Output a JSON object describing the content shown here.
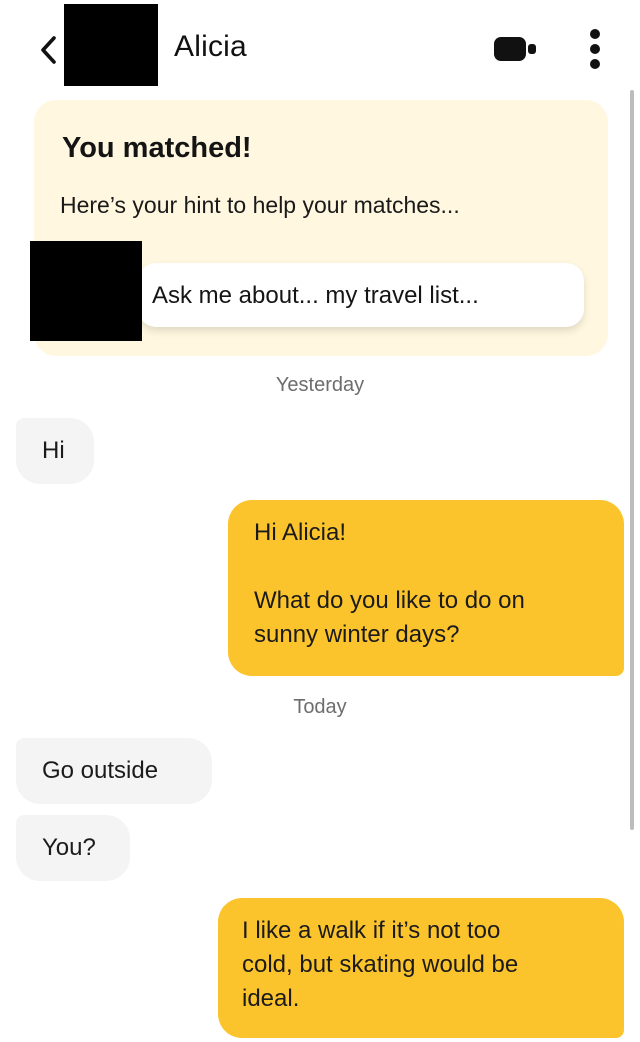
{
  "header": {
    "contact_name": "Alicia",
    "back_icon": "chevron-left-icon",
    "video_icon": "video-camera-icon",
    "more_icon": "more-vertical-icon"
  },
  "match_card": {
    "title": "You matched!",
    "subtitle": "Here’s your hint to help your matches...",
    "hint": "Ask me about... my travel list..."
  },
  "conversation": {
    "date_yesterday": "Yesterday",
    "date_today": "Today",
    "messages": [
      {
        "sender": "them",
        "lines": [
          "Hi"
        ]
      },
      {
        "sender": "me",
        "lines": [
          "Hi Alicia!",
          "What do you like to do on",
          "sunny winter days?"
        ]
      },
      {
        "sender": "them",
        "lines": [
          "Go outside"
        ]
      },
      {
        "sender": "them",
        "lines": [
          "You?"
        ]
      },
      {
        "sender": "me",
        "lines": [
          "I like a walk if it’s not too",
          "cold, but skating would be",
          "ideal."
        ]
      }
    ]
  },
  "colors": {
    "sent_bubble": "#fcc42c",
    "received_bubble": "#f4f4f4",
    "match_card_bg": "#fff7df",
    "date_text": "#6d6d6d"
  }
}
